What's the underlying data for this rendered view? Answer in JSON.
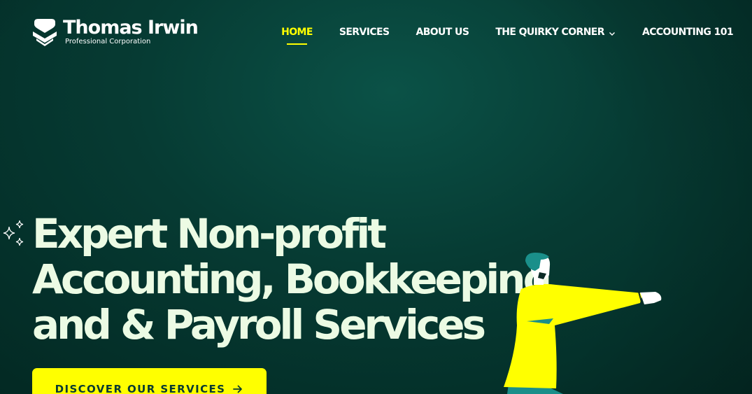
{
  "brand": {
    "name": "Thomas Irwin",
    "tagline": "Professional Corporation",
    "logo_icon": "stacked-chevron-logo-icon"
  },
  "nav": {
    "items": [
      {
        "label": "HOME",
        "active": true
      },
      {
        "label": "SERVICES",
        "active": false
      },
      {
        "label": "ABOUT US",
        "active": false
      },
      {
        "label": "THE QUIRKY CORNER",
        "active": false,
        "has_dropdown": true,
        "icon": "chevron-down-icon"
      },
      {
        "label": "ACCOUNTING 101",
        "active": false
      }
    ]
  },
  "hero": {
    "headline_lines": [
      "Expert Non-profit",
      "Accounting, Bookkeeping",
      "and & Payroll Services"
    ],
    "cta_label": "DISCOVER OUR SERVICES",
    "cta_icon": "arrow-right-icon",
    "decoration_icon": "sparkle-icon",
    "illustration": "pointing-man-illustration"
  },
  "colors": {
    "background": "#063b33",
    "accent": "#ffff00",
    "headline": "#ecfbe4",
    "nav_text": "#ffffff",
    "figure_shirt": "#ffff00",
    "figure_hair": "#1a8f8a"
  }
}
